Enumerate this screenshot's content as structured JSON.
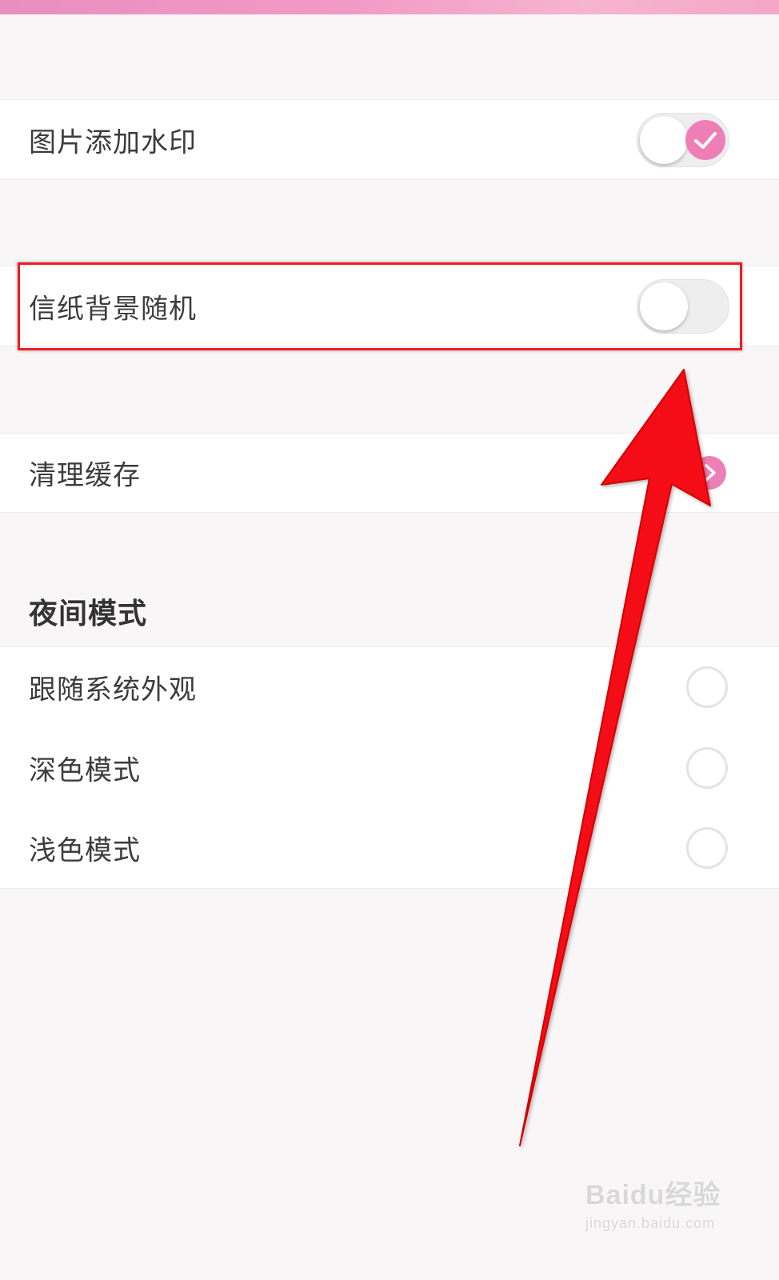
{
  "settings": {
    "watermark_row": {
      "label": "图片添加水印",
      "enabled": true
    },
    "random_paper_row": {
      "label": "信纸背景随机",
      "enabled": false
    },
    "clear_cache_row": {
      "label": "清理缓存"
    }
  },
  "night_mode": {
    "title": "夜间模式",
    "options": [
      {
        "label": "跟随系统外观",
        "selected": false
      },
      {
        "label": "深色模式",
        "selected": false
      },
      {
        "label": "浅色模式",
        "selected": false
      }
    ]
  },
  "colors": {
    "accent_pink": "#ee7fb6",
    "highlight_red": "#ee1c24",
    "background": "#f8f6f7"
  },
  "watermark_logo": {
    "main": "Baidu经验",
    "sub": "jingyan.baidu.com"
  }
}
